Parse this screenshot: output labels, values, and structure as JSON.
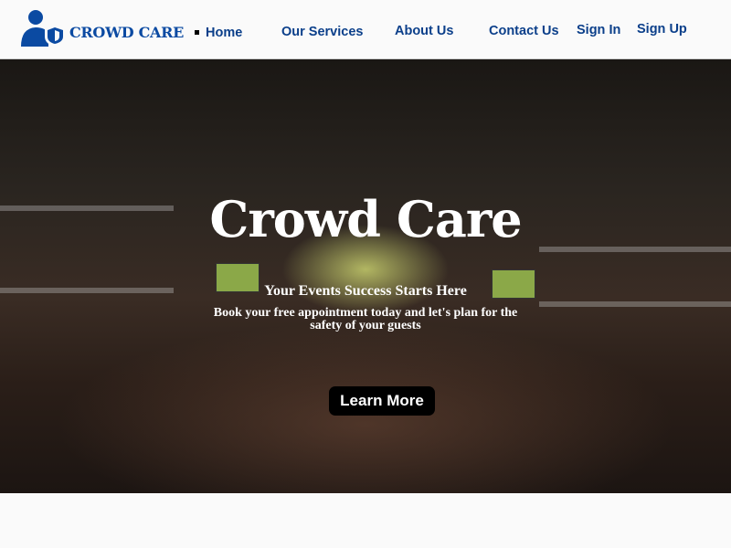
{
  "brand": {
    "name": "CROWD CARE",
    "color": "#0b4aa2"
  },
  "nav": {
    "items": [
      "Home",
      "Our Services",
      "About Us",
      "Contact Us",
      "Sign In",
      "Sign Up"
    ],
    "color": "#0b3f8a"
  },
  "hero": {
    "title": "Crowd Care",
    "subtitle": "Your Events Success Starts Here",
    "description": "Book your free appointment today and let's plan for the safety of your guests",
    "button": "Learn More"
  }
}
